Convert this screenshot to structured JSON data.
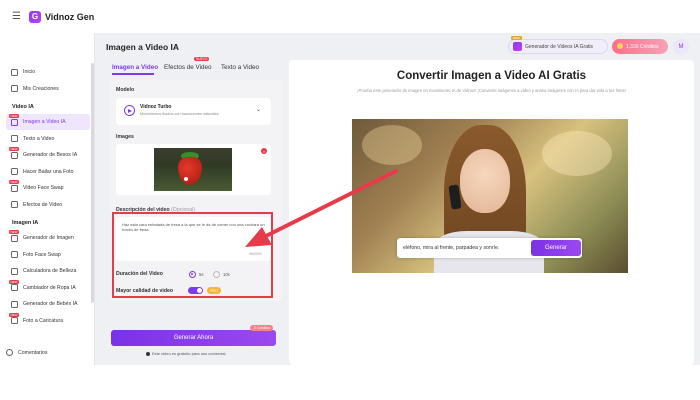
{
  "app": {
    "brand": "Vidnoz Gen",
    "menu_icon": "hamburger-icon"
  },
  "sidebar": {
    "items_top": [
      {
        "label": "Inicio",
        "icon": "home-icon"
      },
      {
        "label": "Mis Creaciones",
        "icon": "folder-icon"
      }
    ],
    "section_video": "Video IA",
    "items_video": [
      {
        "label": "Imagen a Video IA",
        "icon": "image-video-icon",
        "new": true,
        "active": true
      },
      {
        "label": "Texto a Video",
        "icon": "text-video-icon",
        "new": false,
        "active": false
      },
      {
        "label": "Generador de Besos IA",
        "icon": "kiss-icon",
        "new": true,
        "active": false
      },
      {
        "label": "Hacer Bailar una Foto",
        "icon": "dance-icon",
        "new": false,
        "active": false
      },
      {
        "label": "Video Face Swap",
        "icon": "face-swap-icon",
        "new": true,
        "active": false
      },
      {
        "label": "Efectos de Video",
        "icon": "effects-icon",
        "new": false,
        "active": false
      }
    ],
    "section_image": "Imagen IA",
    "items_image": [
      {
        "label": "Generador de Imagen",
        "icon": "image-gen-icon",
        "new": true
      },
      {
        "label": "Foto Face Swap",
        "icon": "photo-swap-icon",
        "new": false
      },
      {
        "label": "Calculadora de Belleza",
        "icon": "beauty-icon",
        "new": false
      },
      {
        "label": "Cambiador de Ropa IA",
        "icon": "clothes-icon",
        "new": true
      },
      {
        "label": "Generador de Bebés IA",
        "icon": "baby-icon",
        "new": false
      },
      {
        "label": "Foto a Caricatura",
        "icon": "cartoon-icon",
        "new": true
      }
    ],
    "new_tag": "NEW",
    "footer": "Comentarios"
  },
  "header": {
    "page_title": "Imagen a Video IA",
    "generator_button": "Generador de Videos IA Gratis",
    "generator_tag": "NEW",
    "credits": "1,330 Créditos",
    "avatar_initial": "M"
  },
  "tabs": [
    {
      "label": "Imagen a Video",
      "active": true
    },
    {
      "label": "Efectos de Video",
      "active": false
    },
    {
      "label": "Texto a Video",
      "active": false
    }
  ],
  "tab_badge": "NUEVO",
  "form": {
    "model_label": "Modelo",
    "model_name": "Vidnoz Turbo",
    "model_desc": "Movimientos fluidos con transiciones naturales.",
    "images_label": "Images",
    "description_label": "Descripción del video",
    "description_optional": "(Opcional)",
    "description_value": "Haz esta cara enfadada de fresa a la que se le da de comer con una cuchara un trocito de fresa.",
    "char_count": "96/2000",
    "duration_label": "Duración del Video",
    "duration_options": [
      "5s",
      "10s"
    ],
    "duration_selected": "5s",
    "quality_label": "Mayor calidad de video",
    "quality_on": true,
    "pro_badge": "PRO",
    "generate_button": "Generar Ahora",
    "cost_badge": "-5 Créditos",
    "free_note": "Este video es gratuito para uso comercial."
  },
  "preview": {
    "title": "Convertir Imagen a Video AI Gratis",
    "description": "¡Prueba este generador de imagen en movimiento IA de Vidnoz! ¡Convierte imágenes a video y anima imágenes con IA para dar vida a tus fotos!",
    "prompt_text": "eléfono, mira al frente, parpadea y sonríe.",
    "prompt_button": "Generar"
  },
  "colors": {
    "accent": "#7d3be8",
    "highlight": "#e53b4b"
  }
}
